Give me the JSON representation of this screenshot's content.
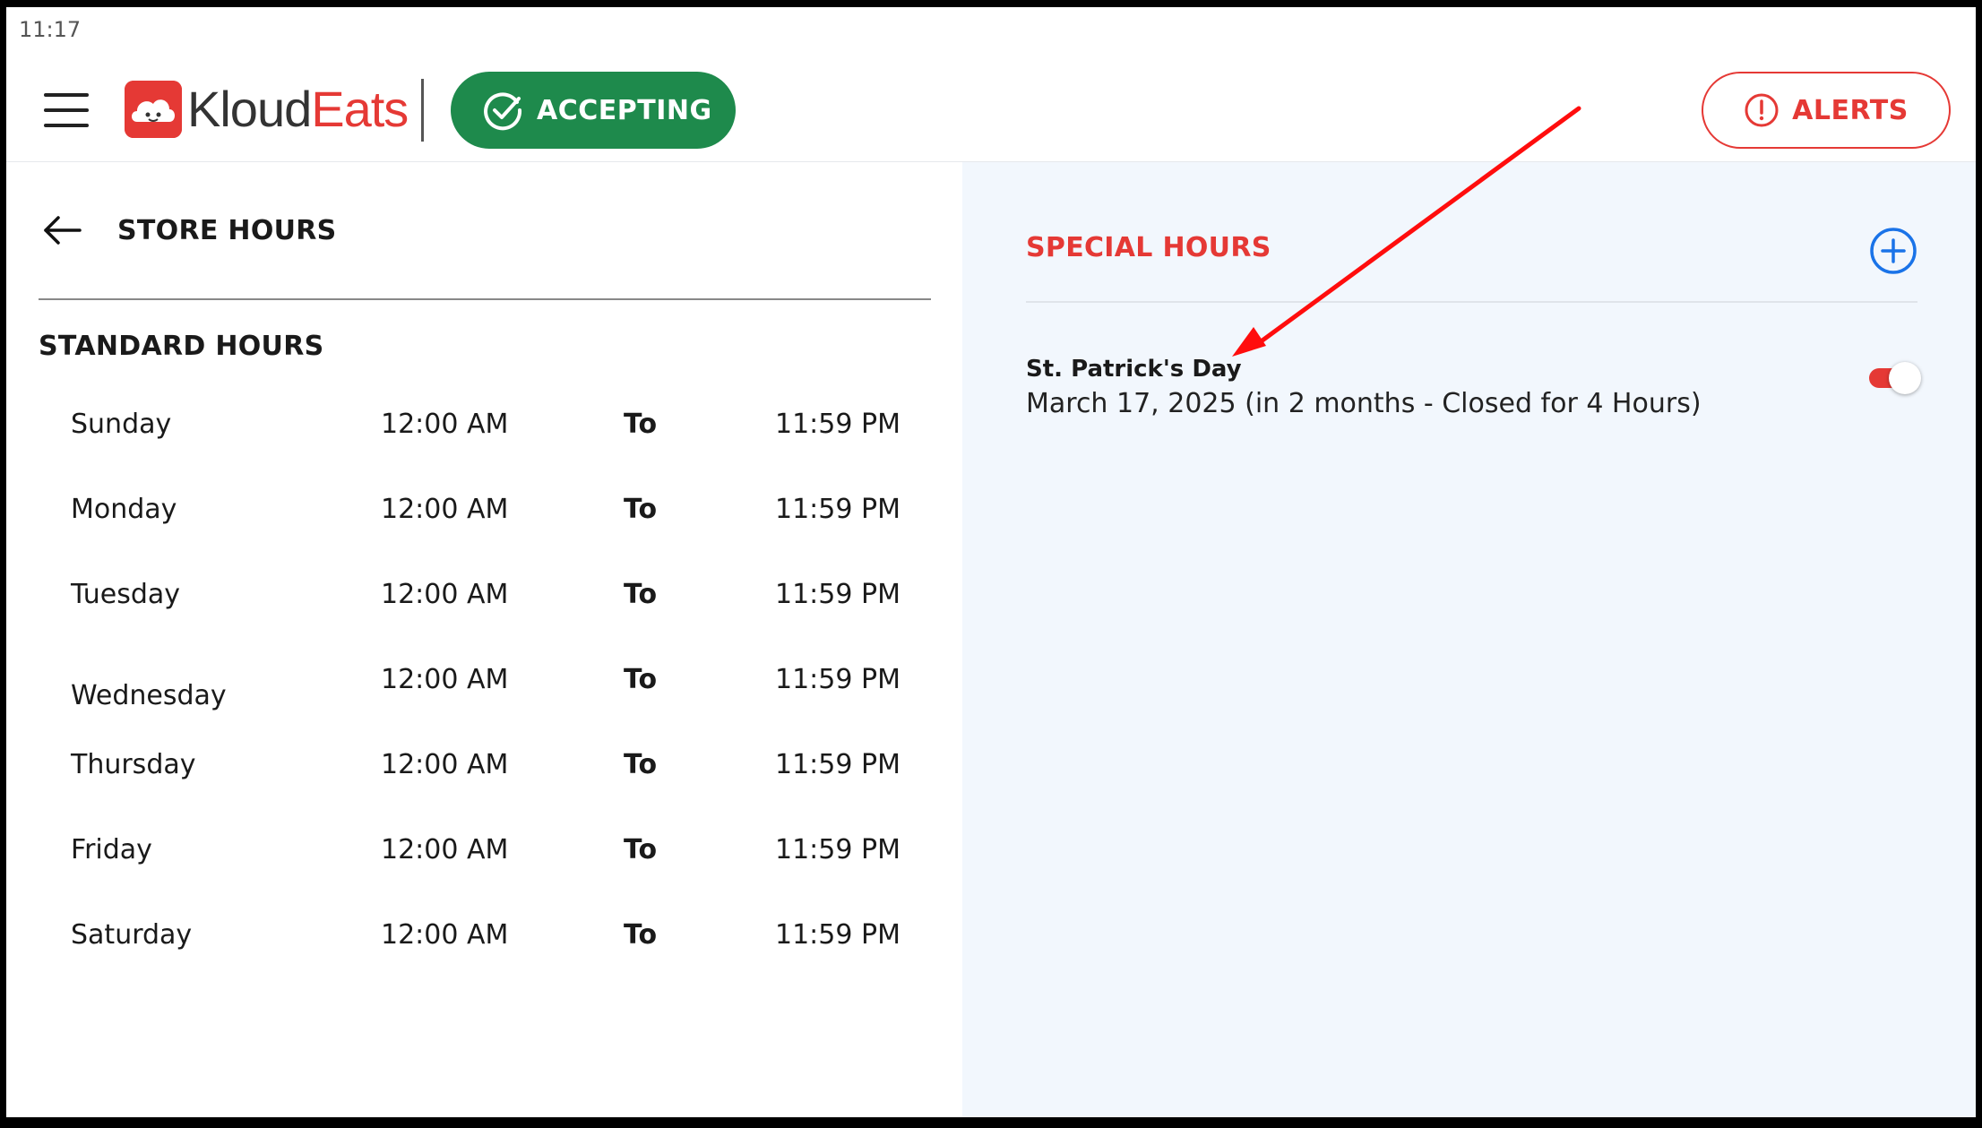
{
  "status_bar": {
    "time": "11:17"
  },
  "header": {
    "logo": {
      "part1": "Kloud",
      "part2": "Eats"
    },
    "accepting_label": "ACCEPTING",
    "alerts_label": "ALERTS"
  },
  "store_hours": {
    "title": "STORE HOURS",
    "standard_title": "STANDARD HOURS",
    "days": [
      {
        "day": "Sunday",
        "open": "12:00 AM",
        "to": "To",
        "close": "11:59 PM"
      },
      {
        "day": "Monday",
        "open": "12:00 AM",
        "to": "To",
        "close": "11:59 PM"
      },
      {
        "day": "Tuesday",
        "open": "12:00 AM",
        "to": "To",
        "close": "11:59 PM"
      },
      {
        "day": "Wednesday",
        "open": "12:00 AM",
        "to": "To",
        "close": "11:59 PM"
      },
      {
        "day": "Thursday",
        "open": "12:00 AM",
        "to": "To",
        "close": "11:59 PM"
      },
      {
        "day": "Friday",
        "open": "12:00 AM",
        "to": "To",
        "close": "11:59 PM"
      },
      {
        "day": "Saturday",
        "open": "12:00 AM",
        "to": "To",
        "close": "11:59 PM"
      }
    ]
  },
  "special_hours": {
    "title": "SPECIAL HOURS",
    "items": [
      {
        "name": "St. Patrick's Day",
        "detail": "March 17, 2025 (in 2 months - Closed for 4 Hours)",
        "enabled": true
      }
    ]
  },
  "colors": {
    "brand_red": "#e53935",
    "accepting_green": "#1e8a4c",
    "add_blue": "#1a73e8",
    "panel_bg": "#f2f7fd"
  },
  "icons": {
    "menu": "hamburger-menu-icon",
    "accepting": "check-circle-icon",
    "alerts": "exclamation-circle-icon",
    "back": "arrow-left-icon",
    "add": "plus-circle-icon",
    "annotation": "red-arrow-annotation"
  }
}
